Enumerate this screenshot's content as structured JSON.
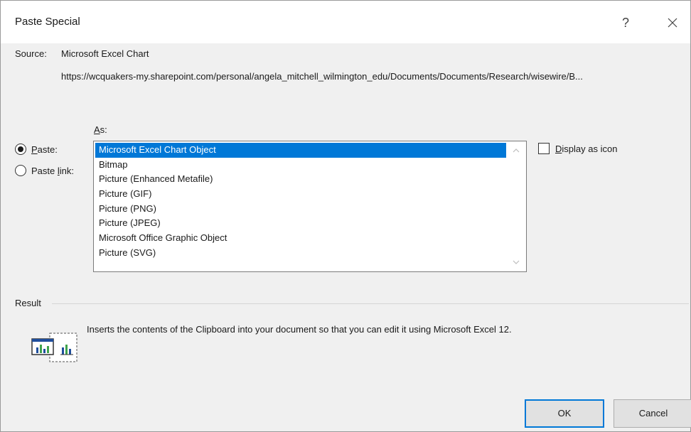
{
  "dialog": {
    "title": "Paste Special",
    "help_label": "?"
  },
  "source": {
    "label": "Source:",
    "name": "Microsoft Excel Chart",
    "url": "https://wcquakers-my.sharepoint.com/personal/angela_mitchell_wilmington_edu/Documents/Documents/Research/wisewire/B..."
  },
  "as": {
    "prefix": "",
    "accel": "A",
    "rest": "s:"
  },
  "radios": [
    {
      "accel": "P",
      "rest": "aste:",
      "checked": true
    },
    {
      "prefix": "Paste ",
      "accel": "l",
      "rest": "ink:",
      "checked": false
    }
  ],
  "list": {
    "items": [
      "Microsoft Excel Chart Object",
      "Bitmap",
      "Picture (Enhanced Metafile)",
      "Picture (GIF)",
      "Picture (PNG)",
      "Picture (JPEG)",
      "Microsoft Office Graphic Object",
      "Picture (SVG)"
    ],
    "selected_index": 0
  },
  "display_as_icon": {
    "accel": "D",
    "rest": "isplay as icon",
    "checked": false
  },
  "result": {
    "label": "Result",
    "text": "Inserts the contents of the Clipboard into your document so that you can edit it using Microsoft Excel 12."
  },
  "buttons": {
    "ok": "OK",
    "cancel": "Cancel"
  },
  "colors": {
    "selection": "#0078d7",
    "dialog_bg": "#f0f0f0",
    "titlebar_bg": "#ffffff"
  }
}
